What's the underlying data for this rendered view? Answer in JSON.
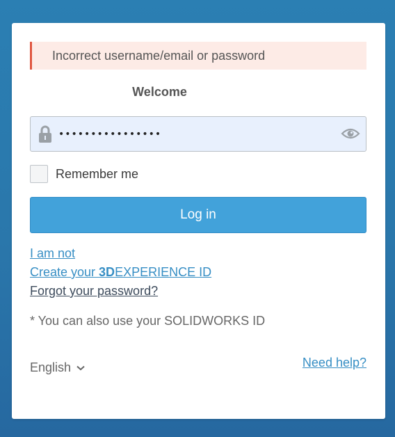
{
  "alert": {
    "message": "Incorrect username/email or password"
  },
  "header": {
    "welcome": "Welcome"
  },
  "password": {
    "value": "••••••••••••••••"
  },
  "remember": {
    "label": "Remember me"
  },
  "login": {
    "label": "Log in"
  },
  "links": {
    "not_me": "I am not ",
    "create_prefix": "Create your ",
    "create_bold": "3D",
    "create_suffix": "EXPERIENCE ID",
    "forgot": "Forgot your password?"
  },
  "note": "* You can also use your SOLIDWORKS ID",
  "language": {
    "selected": "English"
  },
  "help": {
    "label": "Need help?"
  },
  "colors": {
    "accent": "#42a2da",
    "link": "#368ec4",
    "alert_border": "#e0553f",
    "alert_bg": "#fdebe6"
  },
  "icons": [
    "lock-icon",
    "eye-icon",
    "chevron-down-icon"
  ]
}
